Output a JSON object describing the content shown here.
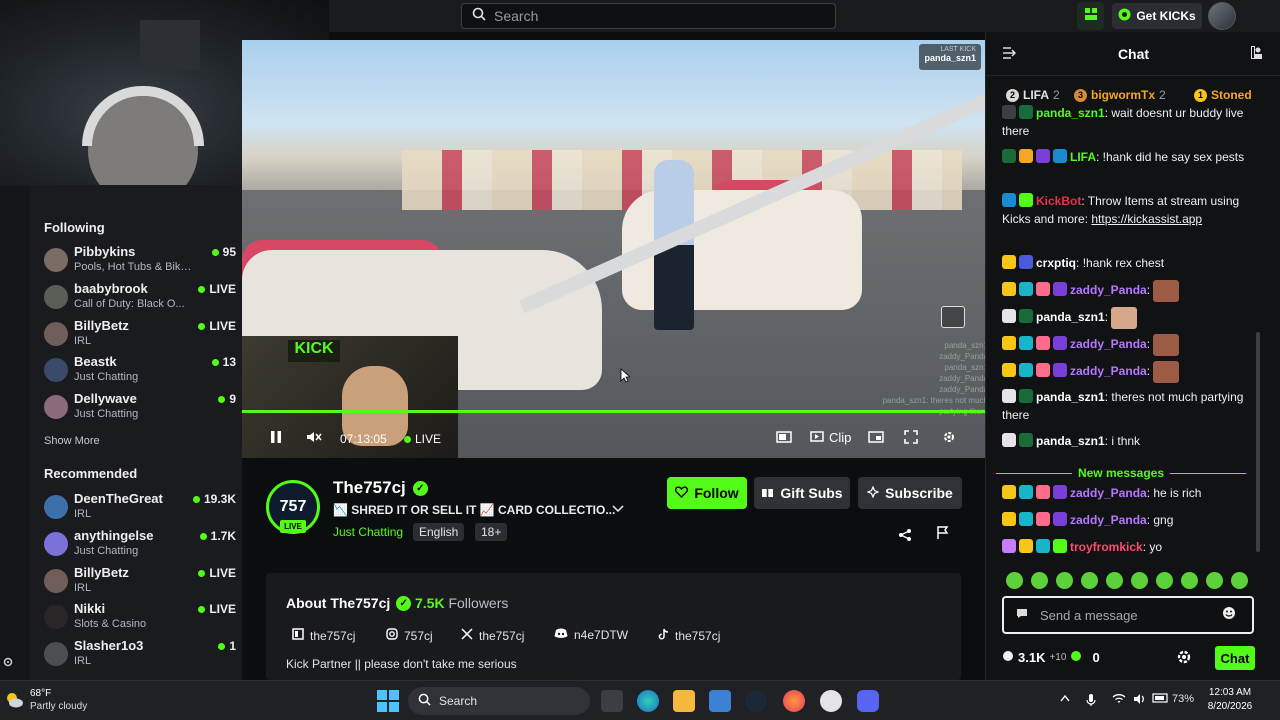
{
  "colors": {
    "accent": "#53fc18",
    "bg": "#0b0e0f",
    "panel": "#191b1f"
  },
  "topbar": {
    "search_placeholder": "Search",
    "get_kicks_label": "Get KICKs"
  },
  "sidebar": {
    "following_heading": "Following",
    "following": [
      {
        "name": "Pibbykins",
        "category": "Pools, Hot Tubs & Bikinis",
        "viewers": "95"
      },
      {
        "name": "baabybrook",
        "category": "Call of Duty: Black O...",
        "viewers": "LIVE"
      },
      {
        "name": "BillyBetz",
        "category": "IRL",
        "viewers": "LIVE"
      },
      {
        "name": "Beastk",
        "category": "Just Chatting",
        "viewers": "13"
      },
      {
        "name": "Dellywave",
        "category": "Just Chatting",
        "viewers": "9"
      }
    ],
    "show_more_label": "Show More",
    "recommended_heading": "Recommended",
    "recommended": [
      {
        "name": "DeenTheGreat",
        "category": "IRL",
        "viewers": "19.3K"
      },
      {
        "name": "anythingelse",
        "category": "Just Chatting",
        "viewers": "1.7K"
      },
      {
        "name": "BillyBetz",
        "category": "IRL",
        "viewers": "LIVE"
      },
      {
        "name": "Nikki",
        "category": "Slots & Casino",
        "viewers": "LIVE"
      },
      {
        "name": "Slasher1o3",
        "category": "IRL",
        "viewers": "1"
      }
    ]
  },
  "player": {
    "last_kick_label": "LAST KICK",
    "last_kick_user": "panda_szn1",
    "pip_logo_text": "KICK",
    "overlay_chat": [
      "panda_szn1",
      "zaddy_Panda",
      "panda_szn1",
      "zaddy_Panda",
      "zaddy_Panda",
      "panda_szn1: theres not much",
      "partying there"
    ],
    "time": "07:13:05",
    "live_label": "LIVE",
    "clip_label": "Clip",
    "progress": 1.0
  },
  "stream": {
    "channel": "The757cj",
    "avatar_text": "757",
    "live_tag": "LIVE",
    "title": "📉 SHRED IT OR SELL IT 📈 CARD COLLECTIO...",
    "category": "Just Chatting",
    "tags": [
      "English",
      "18+"
    ],
    "follow_label": "Follow",
    "gift_label": "Gift Subs",
    "subscribe_label": "Subscribe",
    "about_title": "About The757cj",
    "followers_count": "7.5K",
    "followers_label": "Followers",
    "socials": [
      {
        "icon": "kick-icon",
        "handle": "the757cj"
      },
      {
        "icon": "instagram-icon",
        "handle": "757cj"
      },
      {
        "icon": "x-icon",
        "handle": "the757cj"
      },
      {
        "icon": "discord-icon",
        "handle": "n4e7DTW"
      },
      {
        "icon": "tiktok-icon",
        "handle": "the757cj"
      }
    ],
    "bio": "Kick Partner || please don't take me serious"
  },
  "chat": {
    "title": "Chat",
    "leaderboard": [
      {
        "rank": "2",
        "name": "LIFA",
        "count": "2"
      },
      {
        "rank": "3",
        "name": "bigwormTx",
        "count": "2"
      },
      {
        "rank": "1",
        "name": "Stoned",
        "count": ""
      }
    ],
    "messages": [
      {
        "user": "panda_szn1",
        "color": "#53fc18",
        "text": "wait doesnt ur buddy live there"
      },
      {
        "user": "LIFA",
        "color": "#53fc18",
        "text": "!hank did he say sex pests"
      },
      {
        "user": "KickBot",
        "color": "#e4354a",
        "text": "Throw Items at stream using Kicks and more: ",
        "link": "https://kickassist.app"
      },
      {
        "user": "crxptiq",
        "color": "#ffffff",
        "text": "!hank rex chest"
      },
      {
        "user": "zaddy_Panda",
        "color": "#b778ff",
        "text": ""
      },
      {
        "user": "panda_szn1",
        "color": "#ffffff",
        "text": ""
      },
      {
        "user": "zaddy_Panda",
        "color": "#b778ff",
        "text": ""
      },
      {
        "user": "zaddy_Panda",
        "color": "#b778ff",
        "text": ""
      },
      {
        "user": "panda_szn1",
        "color": "#ffffff",
        "text": "theres not much partying there"
      },
      {
        "user": "panda_szn1",
        "color": "#ffffff",
        "text": "i thnk"
      }
    ],
    "new_messages_label": "New messages",
    "new_messages": [
      {
        "user": "zaddy_Panda",
        "color": "#b778ff",
        "text": "he is rich"
      },
      {
        "user": "zaddy_Panda",
        "color": "#b778ff",
        "text": "gng"
      },
      {
        "user": "troyfromkick",
        "color": "#ff4d6d",
        "text": "yo"
      }
    ],
    "input_placeholder": "Send a message",
    "kicks_count": "3.1K",
    "kicks_plus": "+10",
    "points": "0",
    "send_label": "Chat"
  },
  "taskbar": {
    "temp": "68°F",
    "weather": "Partly cloudy",
    "search_label": "Search",
    "battery": "73%",
    "time": "12:03 AM",
    "date": "8/20/2026"
  }
}
